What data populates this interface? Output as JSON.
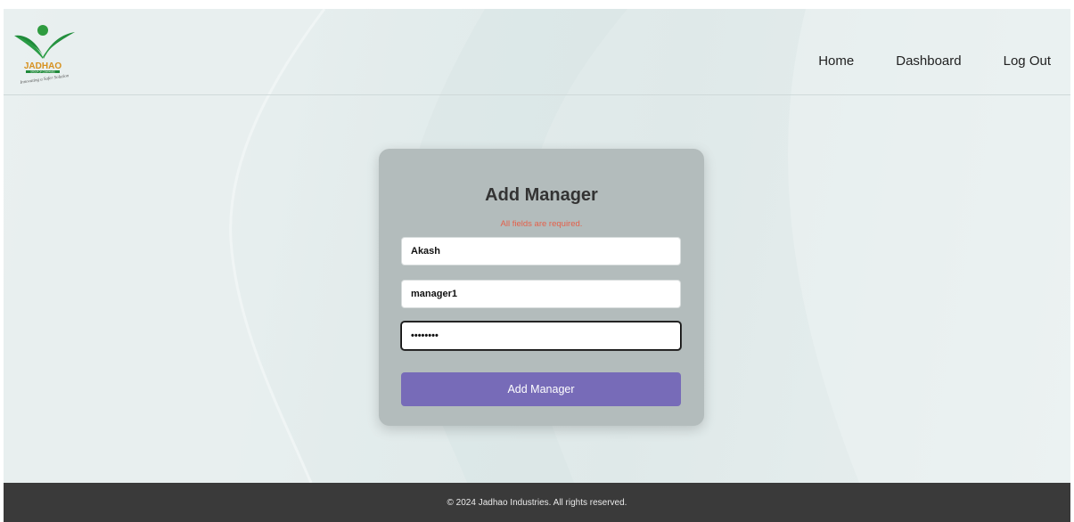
{
  "logo": {
    "brand": "JADHAO",
    "subtitle": "GROUP OF COMPANIES",
    "tagline": "Innovating a Safer Solution",
    "colors": {
      "leaf": "#1f8a3a",
      "dot": "#2e9b3f",
      "brand_text": "#d7911f"
    }
  },
  "nav": {
    "items": [
      {
        "label": "Home"
      },
      {
        "label": "Dashboard"
      },
      {
        "label": "Log Out"
      }
    ]
  },
  "form": {
    "title": "Add Manager",
    "error_message": "All fields are required.",
    "fields": [
      {
        "value": "Akash"
      },
      {
        "value": "manager1"
      },
      {
        "value": "••••••••"
      }
    ],
    "submit_label": "Add Manager"
  },
  "footer": {
    "text": "© 2024 Jadhao Industries. All rights reserved."
  },
  "colors": {
    "accent": "#776bb8",
    "error": "#e4604a",
    "card_bg": "#b3bcbc",
    "footer_bg": "#3a3a3a"
  }
}
